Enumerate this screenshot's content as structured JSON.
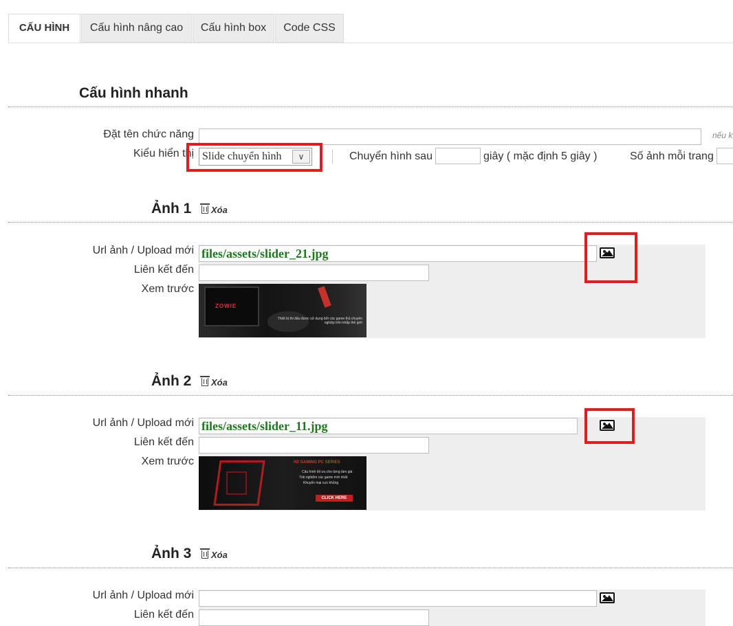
{
  "tabs": [
    {
      "label": "CẤU HÌNH"
    },
    {
      "label": "Cấu hình nâng cao"
    },
    {
      "label": "Cấu hình box"
    },
    {
      "label": "Code CSS"
    }
  ],
  "quick": {
    "title": "Cấu hình nhanh",
    "name_label": "Đặt tên chức năng",
    "name_value": "",
    "name_hint": "nếu k",
    "display_label": "Kiểu hiển thị",
    "display_value": "Slide chuyển hình",
    "transition_label": "Chuyển hình sau",
    "transition_value": "",
    "transition_suffix": "giây ( mặc định 5 giây )",
    "per_page_label": "Số ảnh mỗi trang"
  },
  "images": [
    {
      "title": "Ảnh 1",
      "delete_label": "Xóa",
      "url_label": "Url ảnh / Upload mới",
      "url_value": "files/assets/slider_21.jpg",
      "link_label": "Liên kết đến",
      "link_value": "",
      "preview_label": "Xem trước",
      "preview_brand": "ZOWIE",
      "preview_caption": "Thiết bị thi đấu được sử dụng bởi các game thủ chuyên nghiệp trên khắp thế giới"
    },
    {
      "title": "Ảnh 2",
      "delete_label": "Xóa",
      "url_label": "Url ảnh / Upload mới",
      "url_value": "files/assets/slider_11.jpg",
      "link_label": "Liên kết đến",
      "link_value": "",
      "preview_label": "Xem trước",
      "preview_heading": "H2 GAMING PC SERIES",
      "preview_lines": [
        "Cấu hình tối ưu cho từng tầm giá",
        "Trải nghiệm các game mới nhất",
        "Khuyến mại cực khủng"
      ],
      "preview_button": "CLICK HERE"
    },
    {
      "title": "Ảnh 3",
      "delete_label": "Xóa",
      "url_label": "Url ảnh / Upload mới",
      "url_value": "",
      "link_label": "Liên kết đến",
      "link_value": ""
    }
  ],
  "icons": {
    "select_caret": "chevron-down-icon",
    "upload": "image-icon",
    "delete": "trash-icon"
  },
  "colors": {
    "highlight": "#e41b1b",
    "url_text": "#1a7a1a"
  }
}
